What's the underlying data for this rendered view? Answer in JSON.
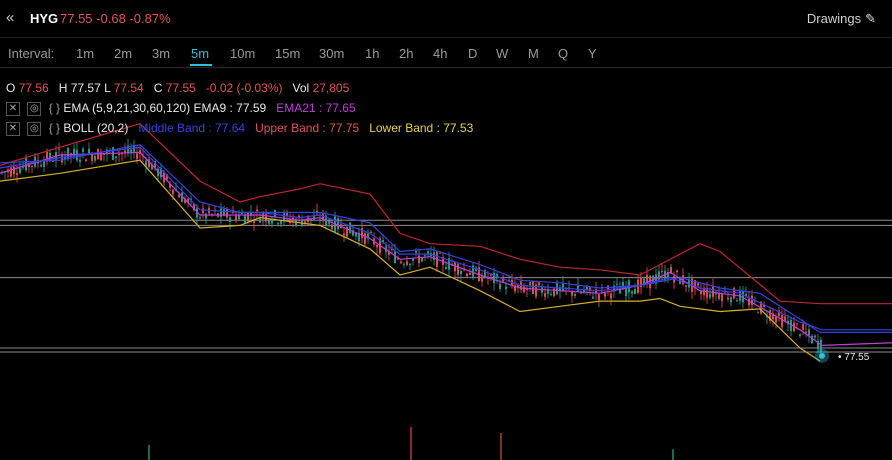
{
  "header": {
    "back_icon": "chevrons-left-icon",
    "symbol": "HYG",
    "price": "77.55",
    "change": "-0.68",
    "change_pct": "-0.87%",
    "drawings_label": "Drawings",
    "drawings_icon": "pencil-icon"
  },
  "intervals": {
    "label": "Interval:",
    "items": [
      "1m",
      "2m",
      "3m",
      "5m",
      "10m",
      "15m",
      "30m",
      "1h",
      "2h",
      "4h",
      "D",
      "W",
      "M",
      "Q",
      "Y"
    ],
    "active": "5m"
  },
  "ohlc": {
    "o_label": "O",
    "o": "77.56",
    "h_label": "H",
    "h": "77.57",
    "l_label": "L",
    "l": "77.54",
    "c_label": "C",
    "c": "77.55",
    "change": "-0.02 (-0.03%)",
    "vol_label": "Vol",
    "vol": "27,805"
  },
  "studies": {
    "ema": {
      "name": "EMA (5,9,21,30,60,120)",
      "ema9": "EMA9 : 77.59",
      "ema21": "EMA21 : 77.65"
    },
    "boll": {
      "name": "BOLL (20,2)",
      "middle": "Middle Band : 77.64",
      "upper": "Upper Band : 77.75",
      "lower": "Lower Band : 77.53"
    }
  },
  "last_price_label": "77.55",
  "colors": {
    "up": "#26a69a",
    "down": "#ef5350",
    "accent": "#2ec1d9",
    "ema9": "#c13fd6",
    "ema21": "#3344dd",
    "upper": "#c0262c",
    "lower": "#d4b02a",
    "middle": "#3344dd"
  },
  "chart_data": {
    "type": "line",
    "title": "",
    "y_range": [
      77.4,
      78.55
    ],
    "horizontal_levels": [
      78.07,
      78.05,
      77.85,
      77.58,
      77.565
    ],
    "series": [
      {
        "name": "Upper Band",
        "x": [
          0,
          60,
          140,
          200,
          240,
          260,
          300,
          320,
          370,
          400,
          430,
          480,
          520,
          560,
          600,
          640,
          700,
          720,
          780,
          820,
          892
        ],
        "values": [
          78.28,
          78.35,
          78.44,
          78.22,
          78.14,
          78.16,
          78.19,
          78.21,
          78.17,
          78.02,
          77.98,
          77.97,
          77.92,
          77.89,
          77.88,
          77.86,
          77.98,
          77.95,
          77.76,
          77.75,
          77.75
        ]
      },
      {
        "name": "Middle Band",
        "x": [
          0,
          60,
          140,
          200,
          240,
          260,
          300,
          320,
          370,
          400,
          430,
          480,
          520,
          560,
          600,
          640,
          680,
          720,
          760,
          800,
          820,
          892
        ],
        "values": [
          78.29,
          78.3,
          78.36,
          78.14,
          78.1,
          78.1,
          78.1,
          78.1,
          78.06,
          77.95,
          77.96,
          77.9,
          77.84,
          77.83,
          77.81,
          77.82,
          77.85,
          77.81,
          77.79,
          77.69,
          77.64,
          77.64
        ]
      },
      {
        "name": "Lower Band",
        "x": [
          0,
          60,
          140,
          200,
          240,
          260,
          300,
          320,
          370,
          400,
          430,
          480,
          520,
          560,
          600,
          640,
          660,
          680,
          720,
          760,
          800,
          820
        ],
        "values": [
          78.22,
          78.25,
          78.3,
          78.04,
          78.05,
          78.08,
          78.06,
          78.05,
          77.96,
          77.86,
          77.89,
          77.8,
          77.72,
          77.74,
          77.76,
          77.76,
          77.77,
          77.74,
          77.72,
          77.73,
          77.58,
          77.53
        ]
      },
      {
        "name": "EMA9",
        "x": [
          0,
          60,
          140,
          200,
          240,
          260,
          300,
          320,
          370,
          400,
          430,
          480,
          520,
          560,
          600,
          640,
          670,
          700,
          740,
          800,
          822,
          892
        ],
        "values": [
          78.25,
          78.32,
          78.33,
          78.09,
          78.09,
          78.09,
          78.07,
          78.08,
          78.0,
          77.92,
          77.93,
          77.86,
          77.81,
          77.8,
          77.79,
          77.82,
          77.87,
          77.8,
          77.78,
          77.65,
          77.59,
          77.6
        ]
      },
      {
        "name": "EMA21",
        "x": [
          0,
          60,
          140,
          200,
          240,
          260,
          300,
          320,
          370,
          400,
          430,
          480,
          520,
          560,
          600,
          640,
          670,
          700,
          740,
          800,
          822,
          892
        ],
        "values": [
          78.27,
          78.31,
          78.35,
          78.11,
          78.1,
          78.1,
          78.08,
          78.09,
          78.02,
          77.94,
          77.94,
          77.88,
          77.82,
          77.81,
          77.8,
          77.82,
          77.85,
          77.81,
          77.79,
          77.68,
          77.65,
          77.65
        ]
      }
    ],
    "volume_bars": [
      {
        "x": 148,
        "v": 0.25
      },
      {
        "x": 410,
        "v": 0.55
      },
      {
        "x": 500,
        "v": 0.45
      },
      {
        "x": 672,
        "v": 0.18
      }
    ]
  }
}
